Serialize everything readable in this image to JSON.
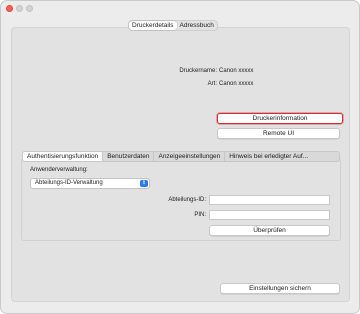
{
  "window": {
    "tabs": [
      "Druckerdetails",
      "Adressbuch"
    ]
  },
  "printer": {
    "name_label": "Druckername:",
    "name_value": "Canon xxxxx",
    "type_label": "Art:",
    "type_value": "Canon xxxxx"
  },
  "buttons": {
    "printer_info": "Druckerinformation",
    "remote_ui": "Remote UI",
    "check": "Überprüfen",
    "save": "Einstellungen sichern"
  },
  "subtabs": [
    "Authentisierungsfunktion",
    "Benutzerdaten",
    "Anzeigeeinstellungen",
    "Hinweis bei erledigter Auf..."
  ],
  "auth": {
    "user_management_label": "Anwenderverwaltung:",
    "user_management_value": "Abteilungs-ID-Verwaltung",
    "dept_id_label": "Abteilungs-ID:",
    "pin_label": "PIN:"
  },
  "colors": {
    "focus_ring": "#d0303b",
    "popup_accent": "#2a7cf6"
  }
}
